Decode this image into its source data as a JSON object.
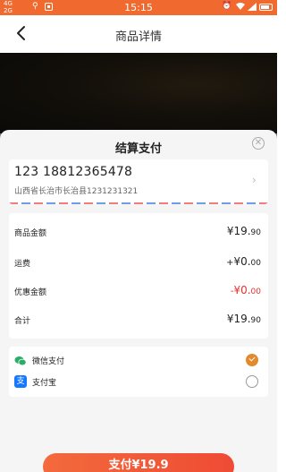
{
  "status_bar": {
    "net_top": "4G",
    "net_bottom": "2G",
    "time": "15:15",
    "accent": "#f06a30"
  },
  "nav": {
    "title": "商品详情",
    "back_icon": "chevron-left-icon"
  },
  "sheet": {
    "title": "结算支付",
    "close_icon": "close-circle-icon"
  },
  "address": {
    "contact": "123 18812365478",
    "address_line": "山西省长治市长治县1231231321"
  },
  "summary": {
    "rows": [
      {
        "label": "商品金额",
        "prefix": "",
        "amount": "¥19.",
        "cents": "90"
      },
      {
        "label": "运费",
        "prefix": "+",
        "amount": "¥0.",
        "cents": "00"
      },
      {
        "label": "优惠金额",
        "prefix": "-",
        "amount": "¥0.",
        "cents": "00"
      },
      {
        "label": "合计",
        "prefix": "",
        "amount": "¥19.",
        "cents": "90"
      }
    ],
    "discount_color": "#e0322e"
  },
  "payment": {
    "methods": [
      {
        "name": "微信支付",
        "icon": "wechat-icon",
        "selected": true
      },
      {
        "name": "支付宝",
        "icon": "alipay-icon",
        "selected": false
      }
    ],
    "alipay_glyph": "支",
    "selected_color": "#e38a2c"
  },
  "pay_button": {
    "label": "支付¥19.9"
  }
}
